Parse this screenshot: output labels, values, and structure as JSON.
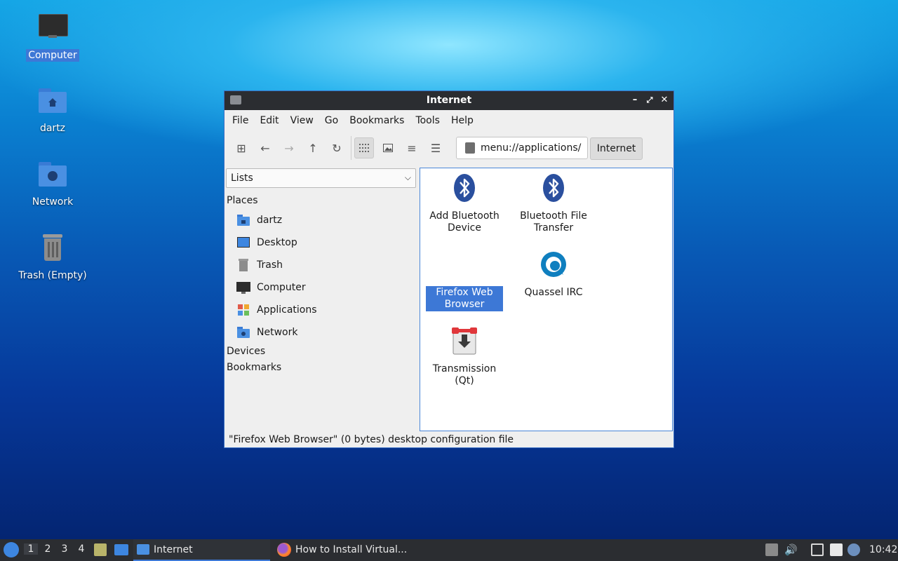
{
  "desktop": {
    "icons": [
      {
        "label": "Computer"
      },
      {
        "label": "dartz"
      },
      {
        "label": "Network"
      },
      {
        "label": "Trash (Empty)"
      }
    ]
  },
  "window": {
    "title": "Internet",
    "menu": [
      "File",
      "Edit",
      "View",
      "Go",
      "Bookmarks",
      "Tools",
      "Help"
    ],
    "address": "menu://applications/",
    "breadcrumb": "Internet",
    "side_combo": "Lists",
    "places_heading": "Places",
    "places": [
      "dartz",
      "Desktop",
      "Trash",
      "Computer",
      "Applications",
      "Network"
    ],
    "devices_heading": "Devices",
    "bookmarks_heading": "Bookmarks",
    "items": [
      {
        "label": "Add Bluetooth Device"
      },
      {
        "label": "Bluetooth File Transfer"
      },
      {
        "label": "Firefox Web Browser"
      },
      {
        "label": "Quassel IRC"
      },
      {
        "label": "Transmission (Qt)"
      }
    ],
    "status": "\"Firefox Web Browser\" (0 bytes) desktop configuration file"
  },
  "taskbar": {
    "workspaces": [
      "1",
      "2",
      "3",
      "4"
    ],
    "tasks": [
      {
        "label": "Internet"
      },
      {
        "label": "How to Install Virtual..."
      }
    ],
    "clock": "10:42"
  },
  "colors": {
    "selection": "#3d78d6",
    "titlebar": "#2b2d31"
  }
}
